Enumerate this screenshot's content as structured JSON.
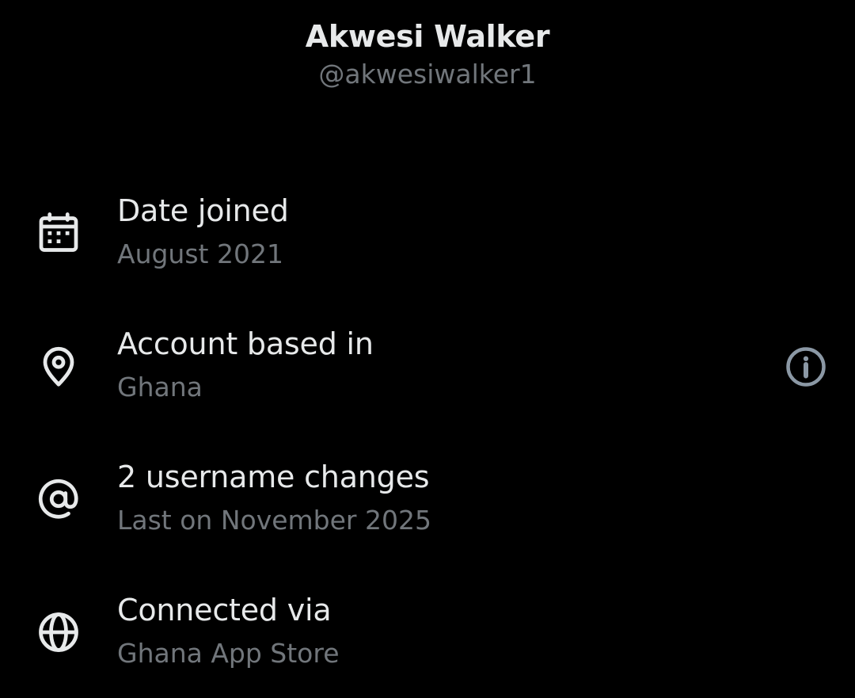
{
  "profile": {
    "display_name": "Akwesi Walker",
    "handle": "@akwesiwalker1"
  },
  "rows": [
    {
      "icon": "calendar-icon",
      "title": "Date joined",
      "subtitle": "August 2021"
    },
    {
      "icon": "location-pin-icon",
      "title": "Account based in",
      "subtitle": "Ghana",
      "action_icon": "info-icon"
    },
    {
      "icon": "at-sign-icon",
      "title": "2 username changes",
      "subtitle": "Last on November 2025"
    },
    {
      "icon": "globe-icon",
      "title": "Connected via",
      "subtitle": "Ghana App Store"
    }
  ],
  "colors": {
    "background": "#000000",
    "primary_text": "#e7e9ea",
    "secondary_text": "#71767b",
    "icon": "#e7e9ea",
    "info_icon": "#8b98a5"
  }
}
